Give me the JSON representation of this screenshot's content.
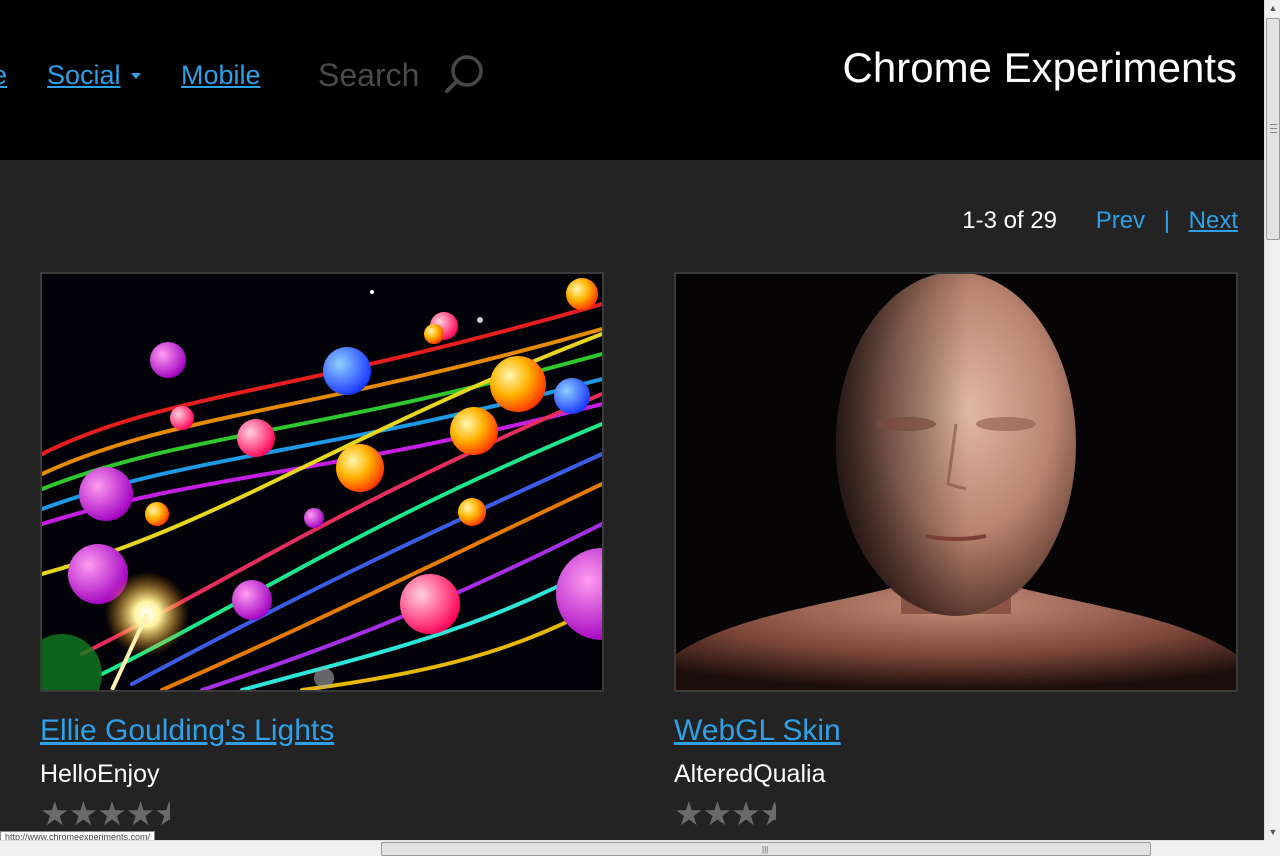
{
  "header": {
    "nav": [
      {
        "label": "e"
      },
      {
        "label": "Social",
        "has_dropdown": true
      },
      {
        "label": "Mobile"
      }
    ],
    "search_placeholder": "Search",
    "search_icon": "search-icon",
    "site_title": "Chrome Experiments"
  },
  "pager": {
    "range_text": "1-3 of 29",
    "prev_label": "Prev",
    "separator": "|",
    "next_label": "Next"
  },
  "experiments": [
    {
      "title": "Ellie Goulding's Lights",
      "author": "HelloEnjoy",
      "rating": 4.5,
      "rating_max": 5
    },
    {
      "title": "WebGL Skin",
      "author": "AlteredQualia",
      "rating": 3.5,
      "rating_max": 5
    }
  ],
  "status_bar": {
    "url": "http://www.chromeexperiments.com/"
  },
  "scrollbars": {
    "vertical_arrow_up": "▲",
    "vertical_arrow_down": "▼",
    "horizontal_grip": "|||"
  },
  "colors": {
    "link": "#2fa0e6",
    "header_bg": "#000000",
    "page_bg": "#232323",
    "text": "#ffffff",
    "star": "#6a6a6a"
  }
}
